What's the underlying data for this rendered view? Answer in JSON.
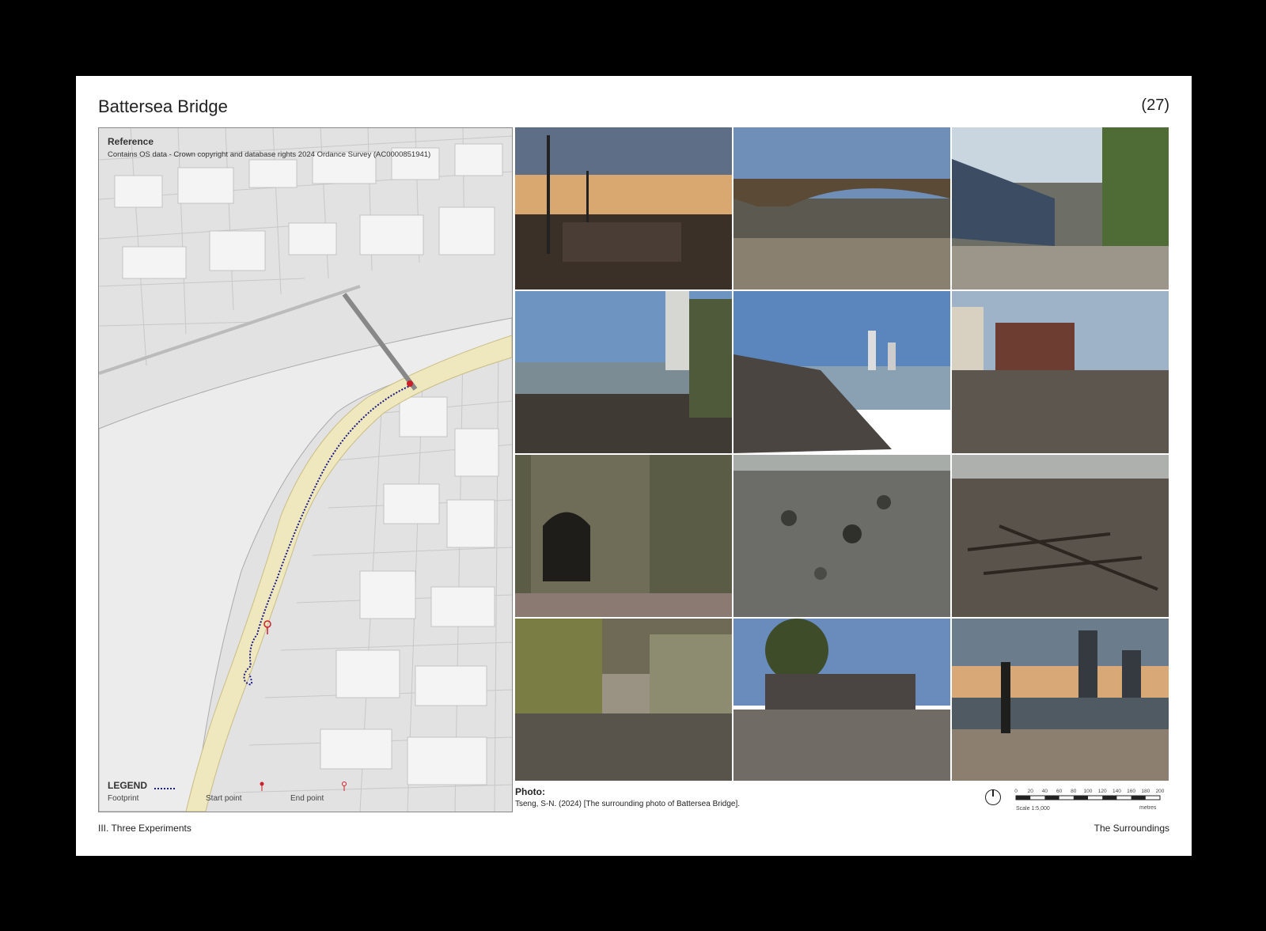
{
  "header": {
    "title": "Battersea Bridge",
    "page_number": "(27)"
  },
  "map": {
    "reference_title": "Reference",
    "reference_text": "Contains OS data - Crown copyright and database rights 2024 Ordance Survey (AC0000851941)",
    "legend_title": "LEGEND",
    "legend_items": [
      "Footprint",
      "Start point",
      "End point"
    ],
    "colors": {
      "river_band": "#efe7bd",
      "footprint": "#1a1a8a",
      "start": "#cc1f2a",
      "end": "#cc1f2a"
    }
  },
  "photos": [
    "lamp-posts-at-embankment",
    "battersea-bridge-arch",
    "moored-boat-foreshore",
    "foreshore-towers-left",
    "pebbles-river-towers",
    "foreshore-brick-buildings",
    "barred-tunnel-gate",
    "pebble-closeup",
    "driftwood-debris",
    "mossy-stairs",
    "beached-houseboat",
    "sunset-skyline-post"
  ],
  "photo_caption": {
    "label": "Photo:",
    "credit": "Tseng, S-N. (2024) [The surrounding photo of Battersea Bridge]."
  },
  "scale_bar": {
    "ticks": [
      "0",
      "20",
      "40",
      "60",
      "80",
      "100",
      "120",
      "140",
      "160",
      "180",
      "200"
    ],
    "scale_text": "Scale 1:5,000",
    "unit": "metres"
  },
  "footer": {
    "left": "III. Three Experiments",
    "right": "The Surroundings"
  }
}
